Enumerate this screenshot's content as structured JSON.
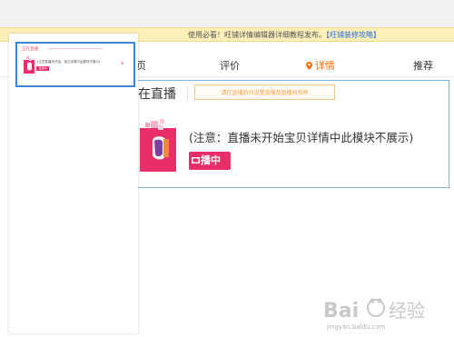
{
  "notice": {
    "text": "使用必看！旺铺详情编辑器详细教程发布。",
    "link": "【旺铺装修攻略】"
  },
  "tabs": {
    "partial": "页",
    "review": "评价",
    "detail": "详情",
    "recommend": "推荐"
  },
  "module": {
    "title": "在直播",
    "input_placeholder": "请在直播后台设置直播及直播间名称",
    "note": "(注意：直播未开始宝贝详情中此模块不展示)",
    "badge": "播中"
  },
  "sidebar": {
    "card_title": "正在直播",
    "card_note": "(注意直播未开始，宝贝详情中此模块不展示)",
    "card_badge": "直播中",
    "arrow": "›"
  },
  "watermark": {
    "brand": "Bai 经验",
    "url": "jingyan.baidu.com"
  },
  "colors": {
    "accent": "#ff6a00",
    "live_pink": "#ea2e6a",
    "selection_blue": "#3a86d8",
    "notice_bg": "#fdefb8"
  }
}
